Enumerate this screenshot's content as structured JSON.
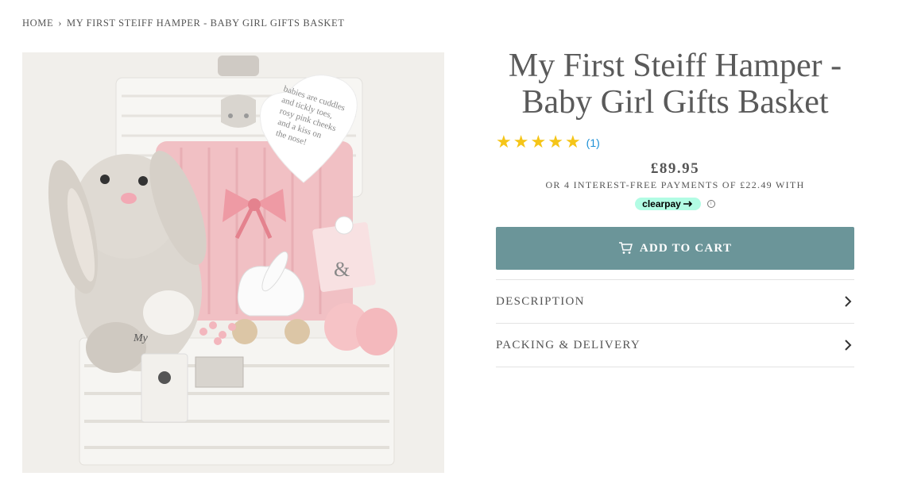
{
  "breadcrumb": {
    "home": "HOME",
    "separator": "›",
    "current": "MY FIRST STEIFF HAMPER - BABY GIRL GIFTS BASKET"
  },
  "product": {
    "image_alt": "Steiff bunny hamper basket",
    "heart_card_text": [
      "babies are cuddles",
      "and tickly toes,",
      "rosy pink cheeks",
      "and a kiss on",
      "the nose!"
    ],
    "title_line1": "My First Steiff Hamper -",
    "title_line2": "Baby Girl Gifts Basket",
    "rating": {
      "stars": 5,
      "count": "(1)",
      "star_color": "#f5c518"
    },
    "price": "£89.95",
    "installments": "OR 4 INTEREST-FREE PAYMENTS OF £22.49 WITH",
    "clearpay_label": "clearpay",
    "info_glyph": "i"
  },
  "actions": {
    "add_to_cart": "ADD TO CART",
    "button_color": "#6b9599"
  },
  "accordion": [
    {
      "label": "DESCRIPTION"
    },
    {
      "label": "PACKING & DELIVERY"
    }
  ],
  "icons": {
    "cart": "cart-icon",
    "chevron": "chevron-right-icon",
    "star": "star-icon"
  }
}
